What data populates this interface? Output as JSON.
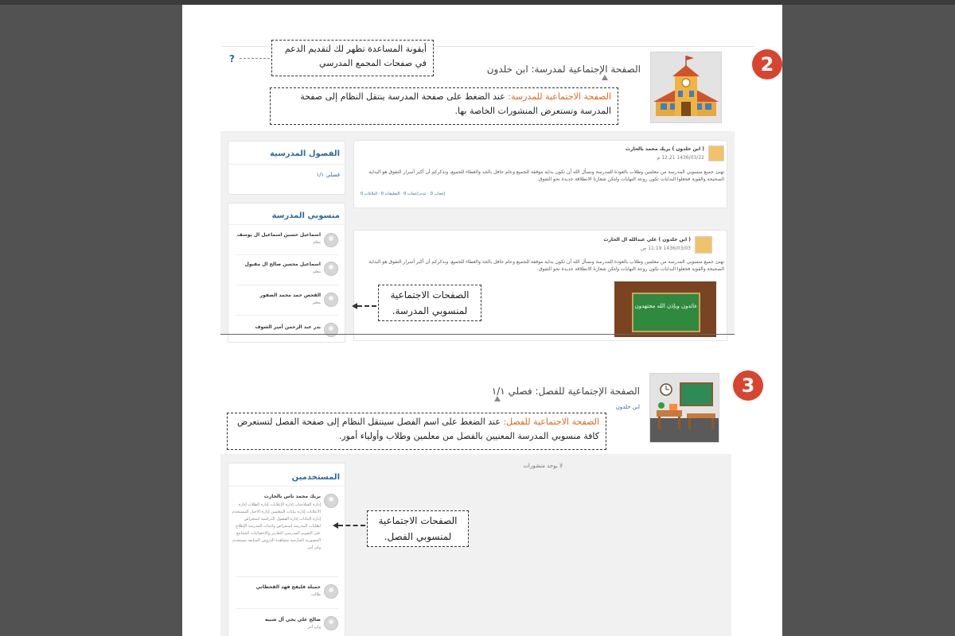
{
  "section2": {
    "number": "2",
    "help_icon": "?",
    "help_callout": "أيقونة المساعدة تظهر لك لتقديم الدعم في صفحات المجمع المدرسي",
    "page_title": "الصفحة الإجتماعية لمدرسة: ابن خلدون",
    "school_callout_label": "الصفحة الاجتماعية للمدرسة:",
    "school_callout_text": "عند الضغط على صفحة المدرسة ينتقل النظام إلى صفحة المدرسة وتستعرض المنشورات الخاصة بها.",
    "classes_card": {
      "title": "الفصول المدرسية",
      "item": "فصلي ١/١"
    },
    "members_card": {
      "title": "منسوبي المدرسة",
      "members": [
        {
          "name": "اسماعيل حسين اسماعيل ال يوسف",
          "role": "معلم"
        },
        {
          "name": "اسماعيل محسن صالح ال مقبول",
          "role": "معلم"
        },
        {
          "name": "القحص حمد محمد الصقور",
          "role": "معلم"
        },
        {
          "name": "بدر عبد الرحمن أمير الشوف",
          "role": "معلم"
        }
      ]
    },
    "members_callout": "الصفحات الاجتماعية لمنسوبي المدرسة.",
    "posts": [
      {
        "author": "( ابن خلدون ) بريك محمد بالحارث",
        "date": "1436/03/22 12:21 م",
        "body": "تهنئ جميع منسوبي المدرسة من معلمين وطلاب بالعودة للمدرسة ونسأل الله أن تكون بداية موفقة للجميع وعام حافل بالجد والعطاء للجميع، ونذكركم أن أكبر أسرار التفوق هو البداية الصحيحة والقوية فجعلوا البدايات تكون روعة النهايات ولتكن شعارنا الانطلاقة جديدة نحو التفوق.",
        "actions": "إعجاب 0 · عدم إعجاب 0 · التعليقات 0 · البلاغات 0"
      },
      {
        "author": "( ابن خلدون ) علي عبدالله ال الحارث",
        "date": "1436/03/03 11:19 ص",
        "body": "تهنئ جميع منسوبي المدرسة من معلمين وطلاب بالعودة للمدرسة ونسأل الله أن تكون بداية موفقة للجميع وعام حافل بالجد والعطاء للجميع، ونذكركم أن أكبر أسرار التفوق هو البداية الصحيحة والقوية فجعلوا البدايات تكون روعة النهايات ولتكن شعارنا الانطلاقة جديدة نحو التفوق.",
        "image_text": "عائدون وبإذن الله مجتهدون"
      }
    ]
  },
  "section3": {
    "number": "3",
    "page_title": "الصفحة الإجتماعية للفصل: فصلي ١/١",
    "school_link": "ابن خلدون",
    "class_callout_label": "الصفحة الاجتماعية للفصل:",
    "class_callout_text": "عند الضغط على اسم الفصل سينتقل النظام إلى صفحة الفصل لتستعرض كافة منسوبي المدرسة المعنيين بالفصل من معلمين وطلاب وأولياء أمور.",
    "no_posts": "لا يوجد منشورات",
    "users_card": {
      "title": "المستخدمين",
      "users": [
        {
          "name": "بريك محمد ناس بالحارث",
          "role": "إدارة الصلاحيات إدارة الإعلانات إدارة الطلاب إدارة الاعلانات إدارة بيانات المعلمين إدارة الاخبار المستخدم إدارة البيانات إدارة الفصول الدراسية استعراض لطلبات المدرسة استعراض واجبات المدرسة الإطلاع على التقويم المدرسي التقارير والإحصائيات المجامع الحضورية الخارجية مشاهدة الدروس المتابعة مستخدم ولي أمر"
        },
        {
          "name": "جميلة فليفح فهد القحطاني",
          "role": "طالب"
        },
        {
          "name": "صالح علي يحي آل شبيه",
          "role": "ولي أمر"
        }
      ]
    },
    "users_callout": "الصفحات الاجتماعية لمنسوبي الفصل."
  }
}
